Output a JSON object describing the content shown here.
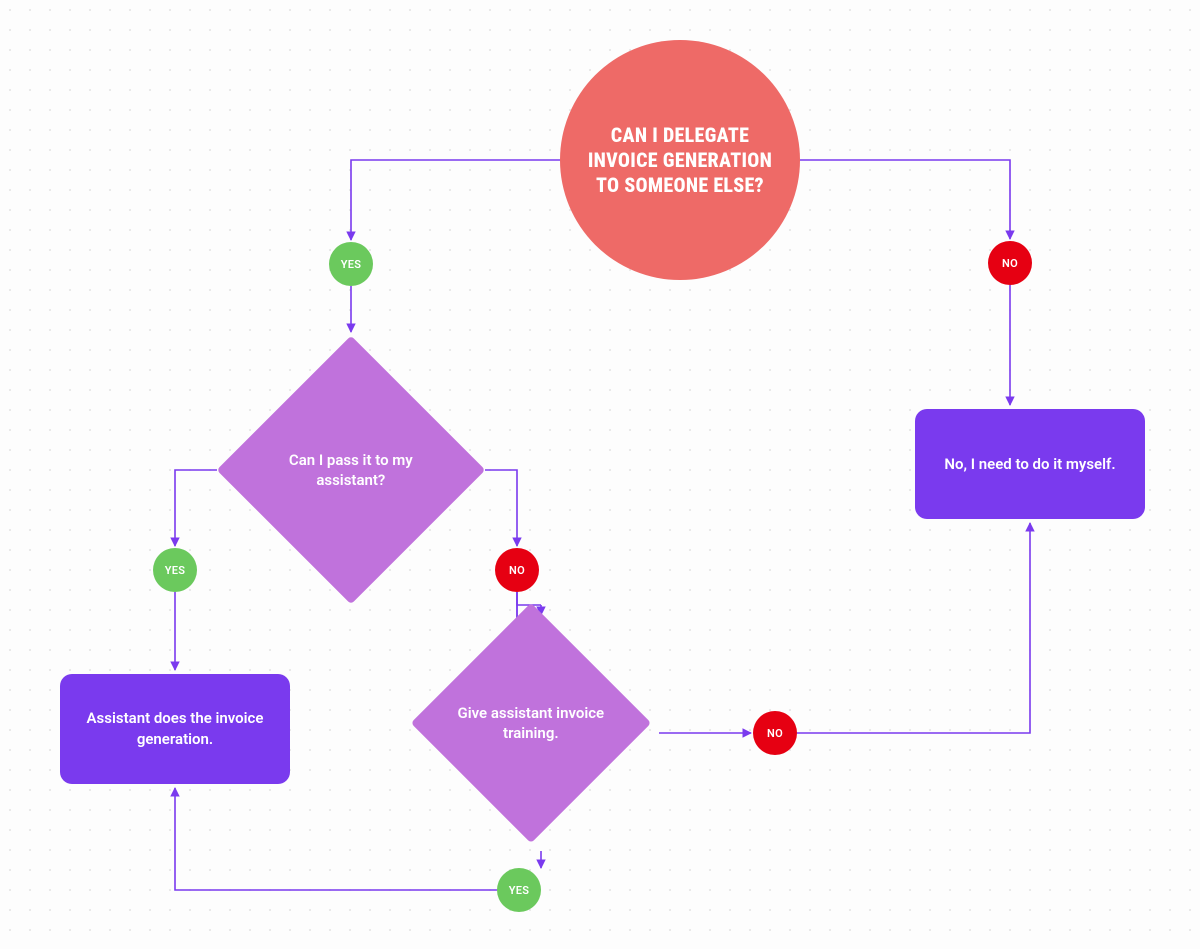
{
  "nodes": {
    "start": {
      "label": "CAN I DELEGATE INVOICE GENERATION TO SOMEONE ELSE?"
    },
    "yes_from_start": {
      "label": "YES"
    },
    "no_from_start": {
      "label": "NO"
    },
    "decision_assistant": {
      "label": "Can I pass it to my assistant?"
    },
    "yes_from_assistant": {
      "label": "YES"
    },
    "no_from_assistant": {
      "label": "NO"
    },
    "decision_training": {
      "label": "Give assistant invoice training."
    },
    "yes_from_training": {
      "label": "YES"
    },
    "no_from_training": {
      "label": "NO"
    },
    "outcome_assistant": {
      "label": "Assistant does the invoice generation."
    },
    "outcome_self": {
      "label": "No, I need to do it myself."
    }
  },
  "flow_description": "Flowchart for delegating invoice generation. Start → yes → 'Can I pass it to my assistant?' → yes → 'Assistant does the invoice generation.' ; 'Can I pass it to my assistant?' → no → 'Give assistant invoice training.' → yes → loops back to 'Assistant does the invoice generation.' ; 'Give assistant invoice training.' → no → 'No, I need to do it myself.' ; Start → no → 'No, I need to do it myself.'",
  "colors": {
    "start_circle": "#ee6a67",
    "yes_circle": "#6bc95d",
    "no_circle": "#e60012",
    "diamond": "#c072dc",
    "box": "#7a3aee",
    "connector": "#7a3aee"
  }
}
